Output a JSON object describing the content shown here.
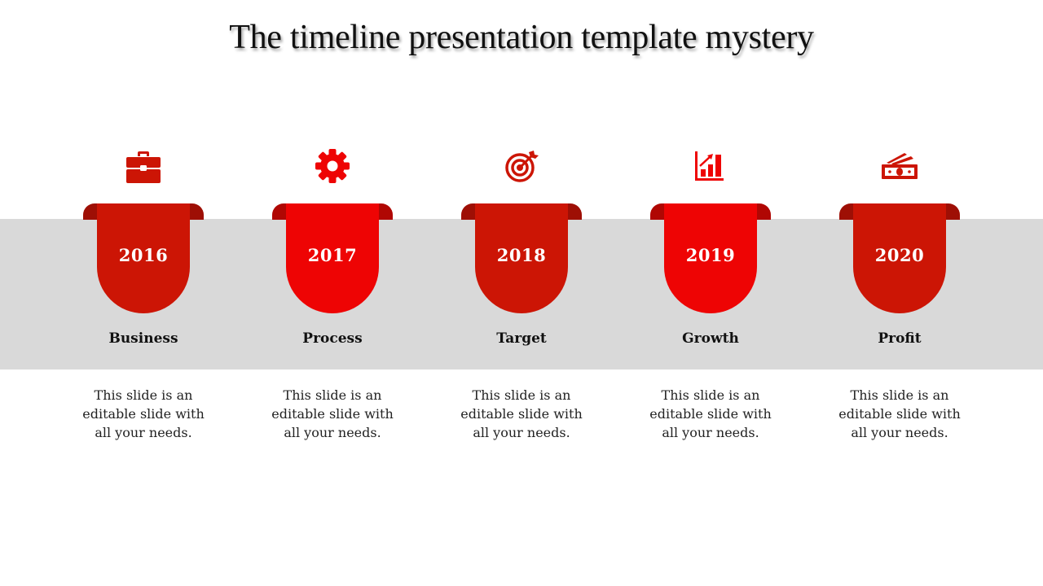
{
  "title": "The timeline presentation template mystery",
  "colors": {
    "dark_red": "#cc1505",
    "bright_red": "#ee0404",
    "dark_tab": "#9e0f05",
    "bright_tab": "#b00703",
    "band": "#d9d9d9"
  },
  "items": [
    {
      "year": "2016",
      "label": "Business",
      "icon": "briefcase-icon",
      "description": "This slide is an editable slide with all your needs.",
      "variant": "dark"
    },
    {
      "year": "2017",
      "label": "Process",
      "icon": "gear-icon",
      "description": "This slide is an editable slide with all your needs.",
      "variant": "bright"
    },
    {
      "year": "2018",
      "label": "Target",
      "icon": "target-icon",
      "description": "This slide is an editable slide with all your needs.",
      "variant": "dark"
    },
    {
      "year": "2019",
      "label": "Growth",
      "icon": "growth-chart-icon",
      "description": "This slide is an editable slide with all your needs.",
      "variant": "bright"
    },
    {
      "year": "2020",
      "label": "Profit",
      "icon": "money-icon",
      "description": "This slide is an editable slide with all your needs.",
      "variant": "dark"
    }
  ]
}
